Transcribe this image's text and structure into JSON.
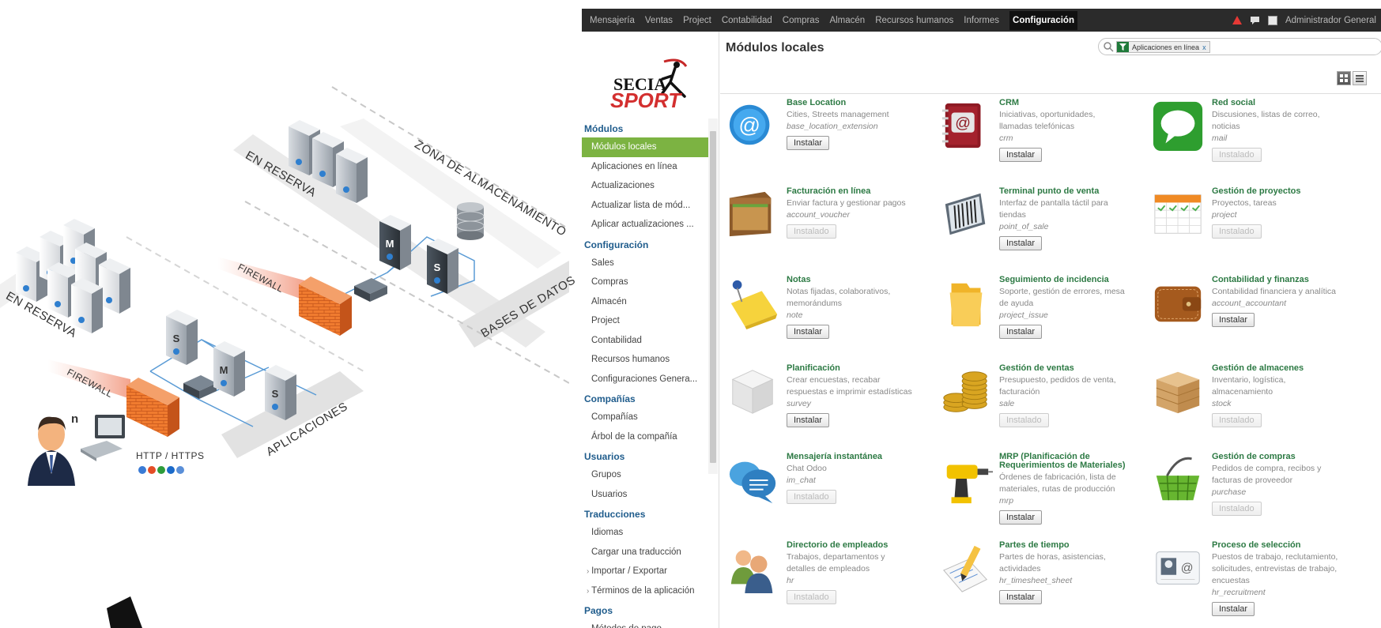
{
  "diagram": {
    "labels": {
      "reserve_top": "EN RESERVA",
      "reserve_left": "EN RESERVA",
      "storage_zone": "ZONA DE ALMACENAMIENTO",
      "databases": "BASES DE DATOS",
      "firewall_top": "FIREWALL",
      "firewall_bottom": "FIREWALL",
      "applications": "APLICACIONES",
      "protocol": "HTTP / HTTPS",
      "user_count": "n",
      "server_master": "M",
      "server_slave": "S"
    }
  },
  "topbar": {
    "menu": [
      "Mensajería",
      "Ventas",
      "Project",
      "Contabilidad",
      "Compras",
      "Almacén",
      "Recursos humanos",
      "Informes",
      "Configuración"
    ],
    "active": "Configuración",
    "user": "Administrador General",
    "alert_color": "#e53935"
  },
  "sidebar": {
    "logo_text_top": "SECIA",
    "logo_text_bottom": "SPORT",
    "sections": [
      {
        "title": "Módulos",
        "items": [
          "Módulos locales",
          "Aplicaciones en línea",
          "Actualizaciones",
          "Actualizar lista de mód...",
          "Aplicar actualizaciones ..."
        ]
      },
      {
        "title": "Configuración",
        "items": [
          "Sales",
          "Compras",
          "Almacén",
          "Project",
          "Contabilidad",
          "Recursos humanos",
          "Configuraciones Genera..."
        ]
      },
      {
        "title": "Compañías",
        "items": [
          "Compañías",
          "Árbol de la compañía"
        ]
      },
      {
        "title": "Usuarios",
        "items": [
          "Grupos",
          "Usuarios"
        ]
      },
      {
        "title": "Traducciones",
        "items": [
          "Idiomas",
          "Cargar una traducción",
          "Importar / Exportar",
          "Términos de la aplicación"
        ]
      },
      {
        "title": "Pagos",
        "items": [
          "Métodos de pago"
        ]
      }
    ],
    "active_item": "Módulos locales",
    "accent_color": "#7cb342"
  },
  "main": {
    "title": "Módulos locales",
    "search_facet": "Aplicaciones en línea",
    "search_facet_close": "x",
    "modules": [
      {
        "name": "Base Location",
        "desc": [
          "Cities, Streets management"
        ],
        "tech": "base_location_extension",
        "button": "Instalar",
        "installed": false,
        "icon": "at-sign-icon"
      },
      {
        "name": "CRM",
        "desc": [
          "Iniciativas, oportunidades,",
          "llamadas telefónicas"
        ],
        "tech": "crm",
        "button": "Instalar",
        "installed": false,
        "icon": "address-book-icon"
      },
      {
        "name": "Red social",
        "desc": [
          "Discusiones, listas de correo,",
          "noticias"
        ],
        "tech": "mail",
        "button": "Instalado",
        "installed": true,
        "icon": "chat-bubble-icon"
      },
      {
        "name": "Facturación en línea",
        "desc": [
          "Enviar factura y gestionar pagos"
        ],
        "tech": "account_voucher",
        "button": "Instalado",
        "installed": true,
        "icon": "wallet-icon"
      },
      {
        "name": "Terminal punto de venta",
        "desc": [
          "Interfaz de pantalla táctil para",
          "tiendas"
        ],
        "tech": "point_of_sale",
        "button": "Instalar",
        "installed": false,
        "icon": "barcode-scanner-icon"
      },
      {
        "name": "Gestión de proyectos",
        "desc": [
          "Proyectos, tareas"
        ],
        "tech": "project",
        "button": "Instalado",
        "installed": true,
        "icon": "calendar-icon"
      },
      {
        "name": "Notas",
        "desc": [
          "Notas fijadas, colaborativos,",
          "memorándums"
        ],
        "tech": "note",
        "button": "Instalar",
        "installed": false,
        "icon": "sticky-note-icon"
      },
      {
        "name": "Seguimiento de incidencia",
        "desc": [
          "Soporte, gestión de errores, mesa",
          "de ayuda"
        ],
        "tech": "project_issue",
        "button": "Instalar",
        "installed": false,
        "icon": "folder-icon"
      },
      {
        "name": "Contabilidad y finanzas",
        "desc": [
          "Contabilidad financiera y analítica"
        ],
        "tech": "account_accountant",
        "button": "Instalar",
        "installed": false,
        "icon": "leather-wallet-icon"
      },
      {
        "name": "Planificación",
        "desc": [
          "Crear encuestas, recabar",
          "respuestas e imprimir estadísticas"
        ],
        "tech": "survey",
        "button": "Instalar",
        "installed": false,
        "icon": "cube-icon"
      },
      {
        "name": "Gestión de ventas",
        "desc": [
          "Presupuesto, pedidos de venta,",
          "facturación"
        ],
        "tech": "sale",
        "button": "Instalado",
        "installed": true,
        "icon": "coins-icon"
      },
      {
        "name": "Gestión de almacenes",
        "desc": [
          "Inventario, logística,",
          "almacenamiento"
        ],
        "tech": "stock",
        "button": "Instalado",
        "installed": true,
        "icon": "crate-icon"
      },
      {
        "name": "Mensajería instantánea",
        "desc": [
          "Chat Odoo"
        ],
        "tech": "im_chat",
        "button": "Instalado",
        "installed": true,
        "icon": "speech-bubbles-icon"
      },
      {
        "name": "MRP (Planificación de Requerimientos de Materiales)",
        "desc": [
          "Órdenes de fabricación, lista de",
          "materiales, rutas de producción"
        ],
        "tech": "mrp",
        "button": "Instalar",
        "installed": false,
        "icon": "drill-icon"
      },
      {
        "name": "Gestión de compras",
        "desc": [
          "Pedidos de compra, recibos y",
          "facturas de proveedor"
        ],
        "tech": "purchase",
        "button": "Instalado",
        "installed": true,
        "icon": "basket-icon"
      },
      {
        "name": "Directorio de empleados",
        "desc": [
          "Trabajos, departamentos y",
          "detalles de empleados"
        ],
        "tech": "hr",
        "button": "Instalado",
        "installed": true,
        "icon": "people-icon"
      },
      {
        "name": "Partes de tiempo",
        "desc": [
          "Partes de horas, asistencias,",
          "actividades"
        ],
        "tech": "hr_timesheet_sheet",
        "button": "Instalar",
        "installed": false,
        "icon": "pencil-sheet-icon"
      },
      {
        "name": "Proceso de selección",
        "desc": [
          "Puestos de trabajo, reclutamiento,",
          "solicitudes, entrevistas de trabajo,",
          "encuestas"
        ],
        "tech": "hr_recruitment",
        "button": "Instalar",
        "installed": false,
        "icon": "id-card-icon"
      }
    ]
  }
}
